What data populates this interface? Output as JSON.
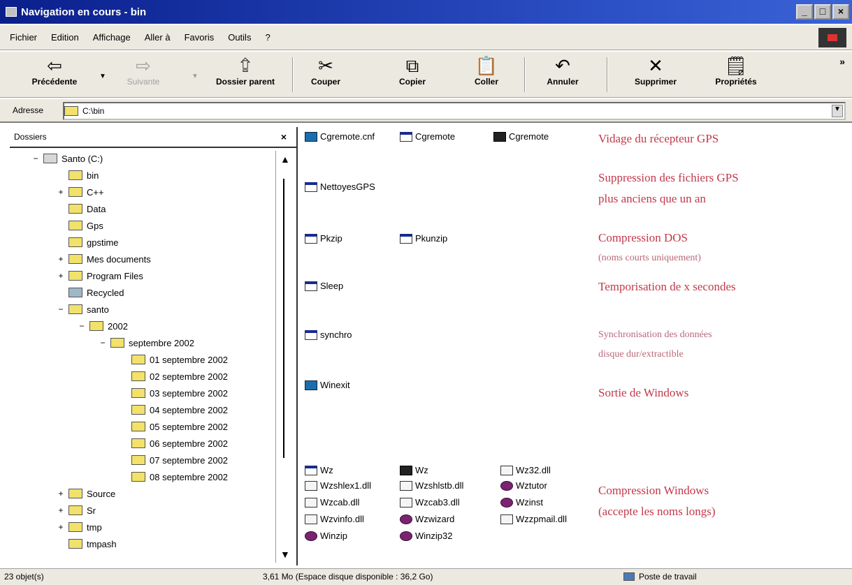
{
  "window": {
    "title": "Navigation en cours - bin",
    "controls": [
      "_",
      "□",
      "×"
    ]
  },
  "menu": [
    "Fichier",
    "Edition",
    "Affichage",
    "Aller à",
    "Favoris",
    "Outils",
    "?"
  ],
  "toolbar": {
    "back": "Précédente",
    "forward": "Suivante",
    "up": "Dossier parent",
    "cut": "Couper",
    "copy": "Copier",
    "paste": "Coller",
    "undo": "Annuler",
    "delete": "Supprimer",
    "properties": "Propriétés",
    "more": "»"
  },
  "address": {
    "label": "Adresse",
    "value": "C:\\bin"
  },
  "folders": {
    "title": "Dossiers",
    "close": "×",
    "tree": [
      {
        "label": "Santo (C:)",
        "exp": "−"
      },
      {
        "label": "bin",
        "exp": ""
      },
      {
        "label": "C++",
        "exp": "+"
      },
      {
        "label": "Data",
        "exp": ""
      },
      {
        "label": "Gps",
        "exp": ""
      },
      {
        "label": "gpstime",
        "exp": ""
      },
      {
        "label": "Mes documents",
        "exp": "+"
      },
      {
        "label": "Program Files",
        "exp": "+"
      },
      {
        "label": "Recycled",
        "exp": ""
      },
      {
        "label": "santo",
        "exp": "−"
      },
      {
        "label": "2002",
        "exp": "−"
      },
      {
        "label": "septembre 2002",
        "exp": "−"
      },
      {
        "label": "01 septembre 2002",
        "exp": ""
      },
      {
        "label": "02 septembre 2002",
        "exp": ""
      },
      {
        "label": "03 septembre 2002",
        "exp": ""
      },
      {
        "label": "04 septembre 2002",
        "exp": ""
      },
      {
        "label": "05 septembre 2002",
        "exp": ""
      },
      {
        "label": "06 septembre 2002",
        "exp": ""
      },
      {
        "label": "07 septembre 2002",
        "exp": ""
      },
      {
        "label": "08 septembre 2002",
        "exp": ""
      },
      {
        "label": "Source",
        "exp": "+"
      },
      {
        "label": "Sr",
        "exp": "+"
      },
      {
        "label": "tmp",
        "exp": "+"
      },
      {
        "label": "tmpash",
        "exp": ""
      }
    ]
  },
  "files": [
    {
      "name": "Cgremote.cnf",
      "icon": "config-file-icon"
    },
    {
      "name": "Cgremote",
      "icon": "program-icon"
    },
    {
      "name": "Cgremote",
      "icon": "gps-program-icon"
    },
    {
      "name": "NettoyesGPS",
      "icon": "program-icon"
    },
    {
      "name": "Pkzip",
      "icon": "program-icon"
    },
    {
      "name": "Pkunzip",
      "icon": "program-icon"
    },
    {
      "name": "Sleep",
      "icon": "program-icon"
    },
    {
      "name": "synchro",
      "icon": "program-icon"
    },
    {
      "name": "Winexit",
      "icon": "exit-program-icon"
    },
    {
      "name": "Wz",
      "icon": "program-icon"
    },
    {
      "name": "Wz",
      "icon": "program-icon"
    },
    {
      "name": "Wz32.dll",
      "icon": "dll-icon"
    },
    {
      "name": "Wzshlex1.dll",
      "icon": "dll-icon"
    },
    {
      "name": "Wzshlstb.dll",
      "icon": "dll-icon"
    },
    {
      "name": "Wztutor",
      "icon": "winzip-icon"
    },
    {
      "name": "Wzcab.dll",
      "icon": "dll-icon"
    },
    {
      "name": "Wzcab3.dll",
      "icon": "dll-icon"
    },
    {
      "name": "Wzinst",
      "icon": "winzip-icon"
    },
    {
      "name": "Wzvinfo.dll",
      "icon": "dll-icon"
    },
    {
      "name": "Wzwizard",
      "icon": "winzip-icon"
    },
    {
      "name": "Wzzpmail.dll",
      "icon": "dll-icon"
    },
    {
      "name": "Winzip",
      "icon": "winzip-icon"
    },
    {
      "name": "Winzip32",
      "icon": "winzip-icon"
    }
  ],
  "annotations": {
    "gps_dump": "Vidage du récepteur GPS",
    "gps_delete_1": "Suppression des fichiers GPS",
    "gps_delete_2": "plus anciens que un an",
    "dos_1": "Compression DOS",
    "dos_2": "(noms courts uniquement)",
    "sleep": "Temporisation de x secondes",
    "sync_1": "Synchronisation des données",
    "sync_2": "disque dur/extractible",
    "exit": "Sortie de Windows",
    "win_1": "Compression Windows",
    "win_2": "(accepte les noms longs)"
  },
  "status": {
    "objects": "23 objet(s)",
    "space": "3,61 Mo (Espace disque disponible : 36,2 Go)",
    "zone": "Poste de travail"
  },
  "colors": {
    "annotation": "#c2384a",
    "titlebar": "#0a1f8c"
  }
}
